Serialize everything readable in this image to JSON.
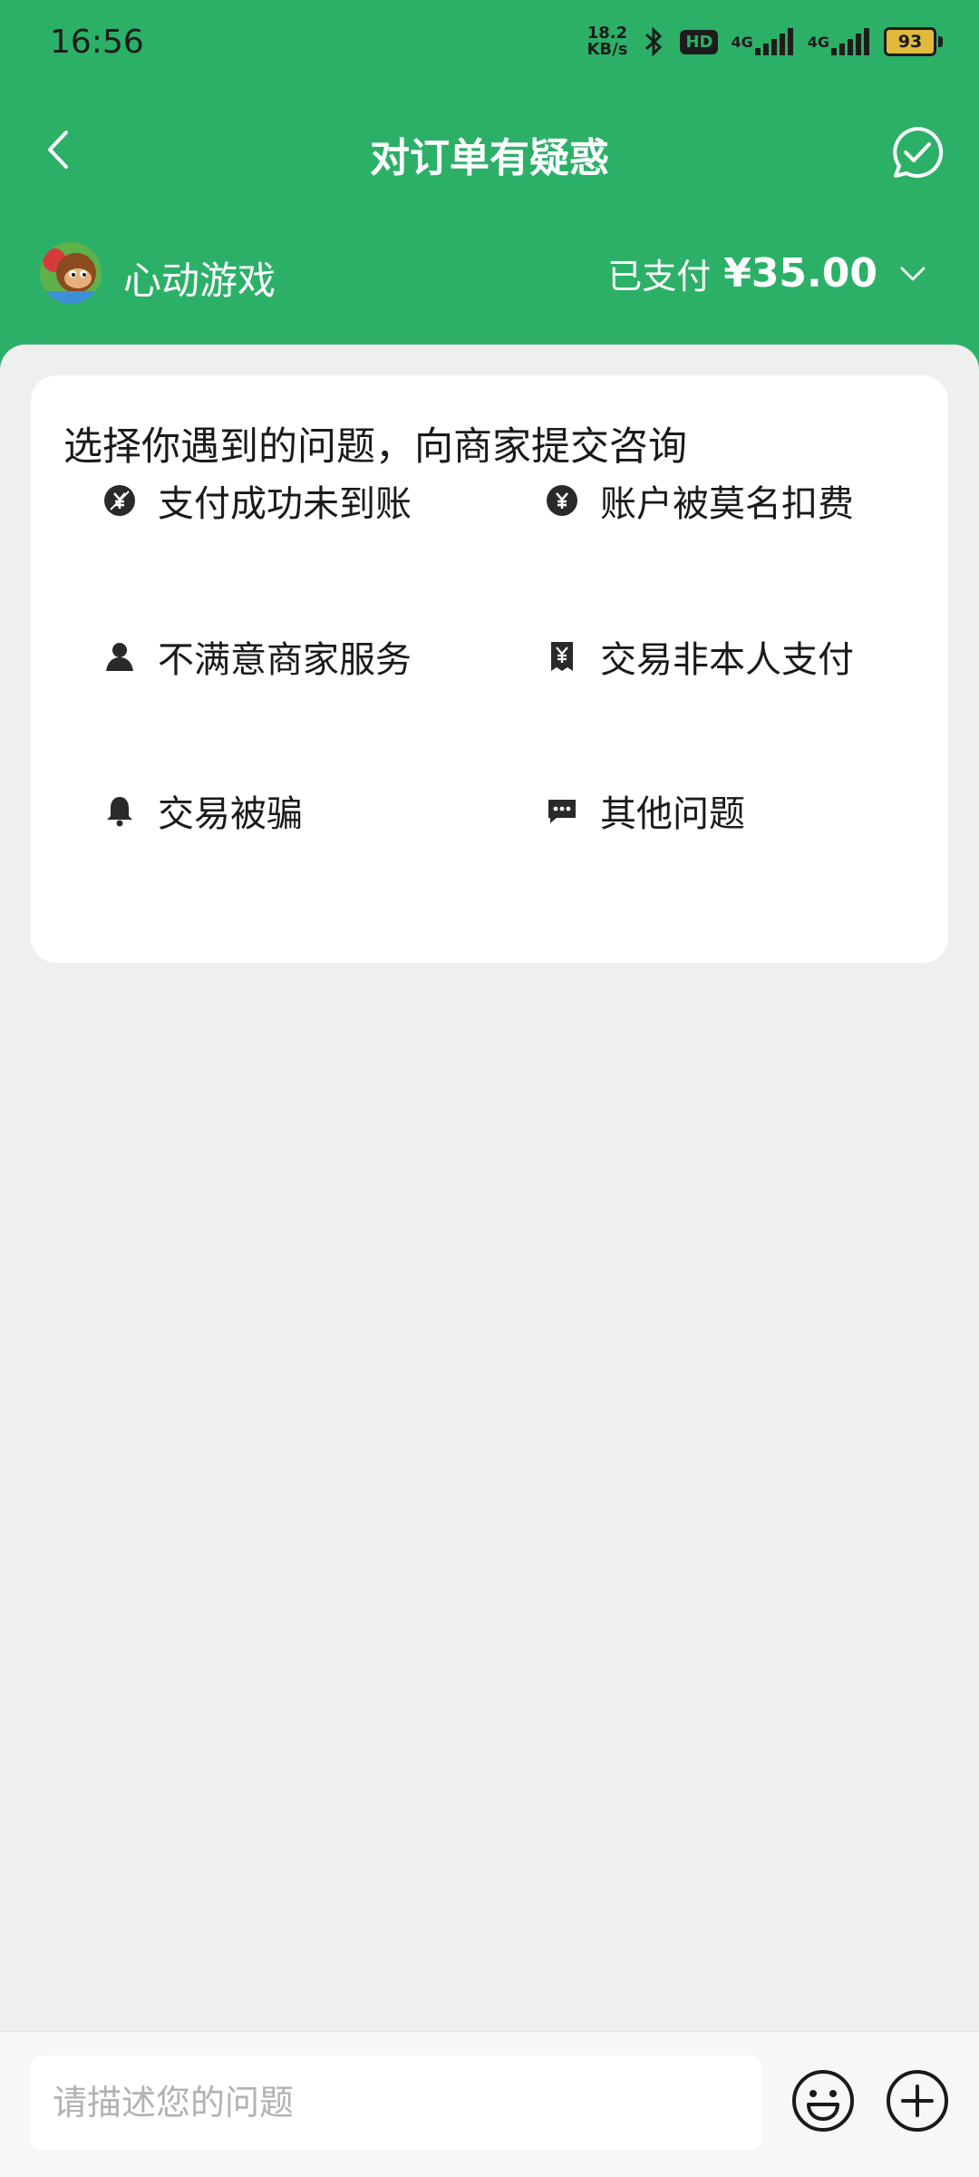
{
  "status_bar": {
    "time": "16:56",
    "net_speed_value": "18.2",
    "net_speed_unit": "KB/s",
    "hd_label": "HD",
    "signal_label": "4G",
    "battery": "93"
  },
  "header": {
    "title": "对订单有疑惑"
  },
  "merchant": {
    "name": "心动游戏",
    "pay_status": "已支付",
    "amount": "¥35.00"
  },
  "issue_card": {
    "title": "选择你遇到的问题，向商家提交咨询",
    "options": [
      {
        "label": "支付成功未到账",
        "icon": "yuan-coin-slash-icon"
      },
      {
        "label": "账户被莫名扣费",
        "icon": "yuan-coin-icon"
      },
      {
        "label": "不满意商家服务",
        "icon": "person-icon"
      },
      {
        "label": "交易非本人支付",
        "icon": "yuan-ticket-icon"
      },
      {
        "label": "交易被骗",
        "icon": "bell-icon"
      },
      {
        "label": "其他问题",
        "icon": "chat-bubble-icon"
      }
    ]
  },
  "input_bar": {
    "placeholder": "请描述您的问题"
  },
  "colors": {
    "brand_green": "#2cb068",
    "background": "#efefef",
    "card": "#ffffff",
    "text": "#1a1a1a"
  }
}
